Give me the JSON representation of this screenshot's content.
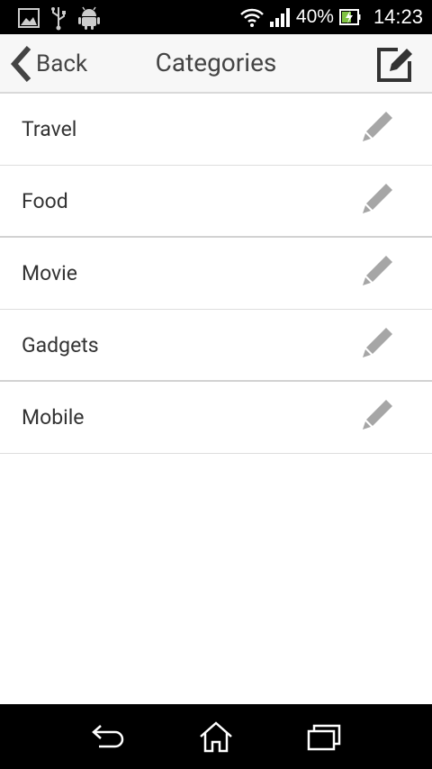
{
  "status_bar": {
    "battery_percent": "40%",
    "time": "14:23",
    "icons": [
      "gallery-icon",
      "usb-icon",
      "android-icon",
      "wifi-icon",
      "signal-icon",
      "battery-charging-icon"
    ]
  },
  "action_bar": {
    "back_label": "Back",
    "title": "Categories"
  },
  "categories": [
    "Travel",
    "Food",
    "Movie",
    "Gadgets",
    "Mobile"
  ],
  "nav_bar": {
    "buttons": [
      "back-nav-icon",
      "home-nav-icon",
      "recents-nav-icon"
    ]
  },
  "colors": {
    "status_bar": "#000000",
    "action_bar": "#f7f7f7",
    "divider": "#dedede",
    "text": "#333333",
    "pencil": "#a6a6a6"
  }
}
